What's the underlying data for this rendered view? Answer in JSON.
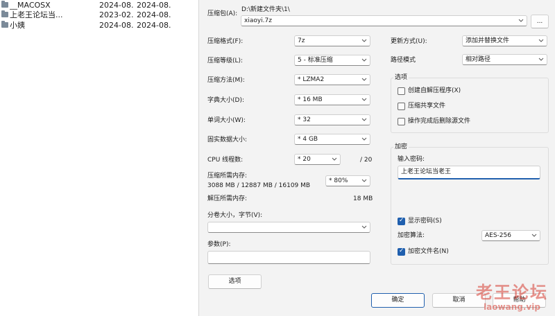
{
  "files": [
    {
      "name": "__MACOSX",
      "date1": "2024-08...",
      "date2": "2024-08..."
    },
    {
      "name": "上老王论坛当...",
      "date1": "2023-02...",
      "date2": "2024-08..."
    },
    {
      "name": "小姨",
      "date1": "2024-08...",
      "date2": "2024-08..."
    }
  ],
  "archive": {
    "label": "压缩包(A):",
    "path": "D:\\新建文件夹\\1\\",
    "filename": "xiaoyi.7z",
    "browse_label": "..."
  },
  "left": {
    "format_label": "压缩格式(F):",
    "format_value": "7z",
    "level_label": "压缩等级(L):",
    "level_value": "5 - 标准压缩",
    "method_label": "压缩方法(M):",
    "method_value": "* LZMA2",
    "dict_label": "字典大小(D):",
    "dict_value": "* 16 MB",
    "word_label": "单词大小(W):",
    "word_value": "* 32",
    "solid_label": "固实数据大小:",
    "solid_value": "* 4 GB",
    "cpu_label": "CPU 线程数:",
    "cpu_value": "* 20",
    "cpu_total": "/ 20",
    "mem_label": "压缩所需内存:",
    "mem_detail": "3088 MB / 12887 MB / 16109 MB",
    "mem_value": "* 80%",
    "decomp_label": "解压所需内存:",
    "decomp_value": "18 MB",
    "split_label": "分卷大小，字节(V):",
    "split_value": "",
    "params_label": "参数(P):",
    "params_value": "",
    "options_button": "选项"
  },
  "right": {
    "update_label": "更新方式(U):",
    "update_value": "添加并替换文件",
    "path_label": "路径模式",
    "path_value": "相对路径",
    "options_group": "选项",
    "opt_sfx": "创建自解压程序(X)",
    "opt_shared": "压缩共享文件",
    "opt_delete": "操作完成后删除源文件",
    "encrypt_group": "加密",
    "password_label": "输入密码:",
    "password_value": "上老王论坛当老王",
    "show_password": "显示密码(S)",
    "algo_label": "加密算法:",
    "algo_value": "AES-256",
    "encrypt_names": "加密文件名(N)"
  },
  "buttons": {
    "ok": "确定",
    "cancel": "取消",
    "help": "帮助"
  },
  "watermark": {
    "cn": "老王论坛",
    "url": "laowang.vip"
  },
  "colors": {
    "accent": "#1f5fae",
    "dialog_bg": "#f3f3f3",
    "watermark": "#d63c32"
  }
}
